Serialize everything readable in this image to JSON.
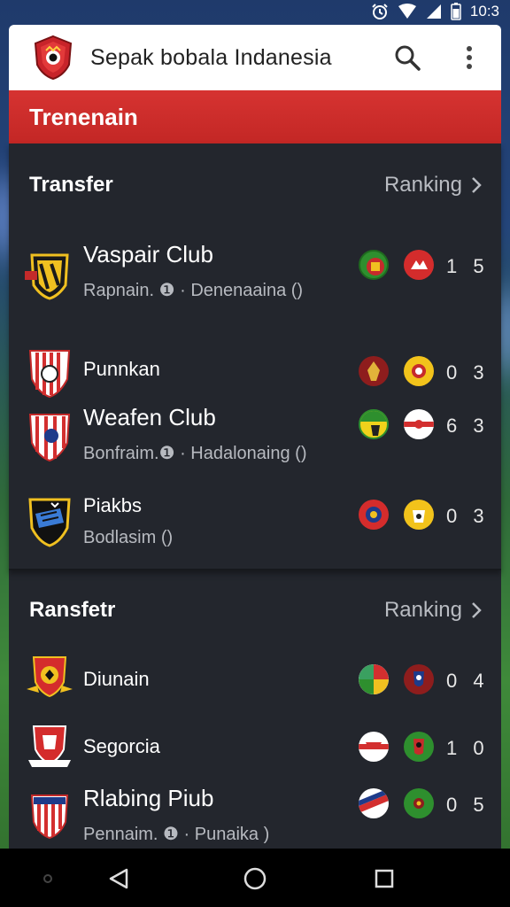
{
  "status": {
    "time": "10:3"
  },
  "appbar": {
    "title": "Sepak bobala Indanesia",
    "logo_icon": "club-crest-icon",
    "search_icon": "search-icon",
    "more_icon": "more-vert-icon"
  },
  "banner": {
    "title": "Trenenain"
  },
  "sections": [
    {
      "title": "Transfer",
      "link": "Ranking",
      "rows": [
        {
          "name": "Vaspair Club",
          "sub": "Rapnain. ❶ · Denenaaina ()",
          "score": "1 5"
        },
        {
          "name": "Punnkan",
          "sub": "",
          "score": "0 3"
        },
        {
          "name": "Weafen Club",
          "sub": "Bonfraim.❶ · Hadalonaing ()",
          "score": "6 3"
        },
        {
          "name": "Piakbs",
          "sub": "Bodlasim ()",
          "score": "0 3"
        }
      ]
    },
    {
      "title": "Ransfetr",
      "link": "Ranking",
      "rows": [
        {
          "name": "Diunain",
          "sub": "",
          "score": "0 4"
        },
        {
          "name": "Segorcia",
          "sub": "",
          "score": "1 0"
        },
        {
          "name": "Rlabing Piub",
          "sub": "Pennaim. ❶ · Punaika )",
          "score": "0 5"
        }
      ]
    }
  ],
  "colors": {
    "accent_red": "#d2302e",
    "panel": "#23262d",
    "appbar": "#ffffff"
  },
  "navbar": {
    "back_icon": "back-triangle-icon",
    "home_icon": "home-circle-icon",
    "recents_icon": "recents-square-icon"
  }
}
